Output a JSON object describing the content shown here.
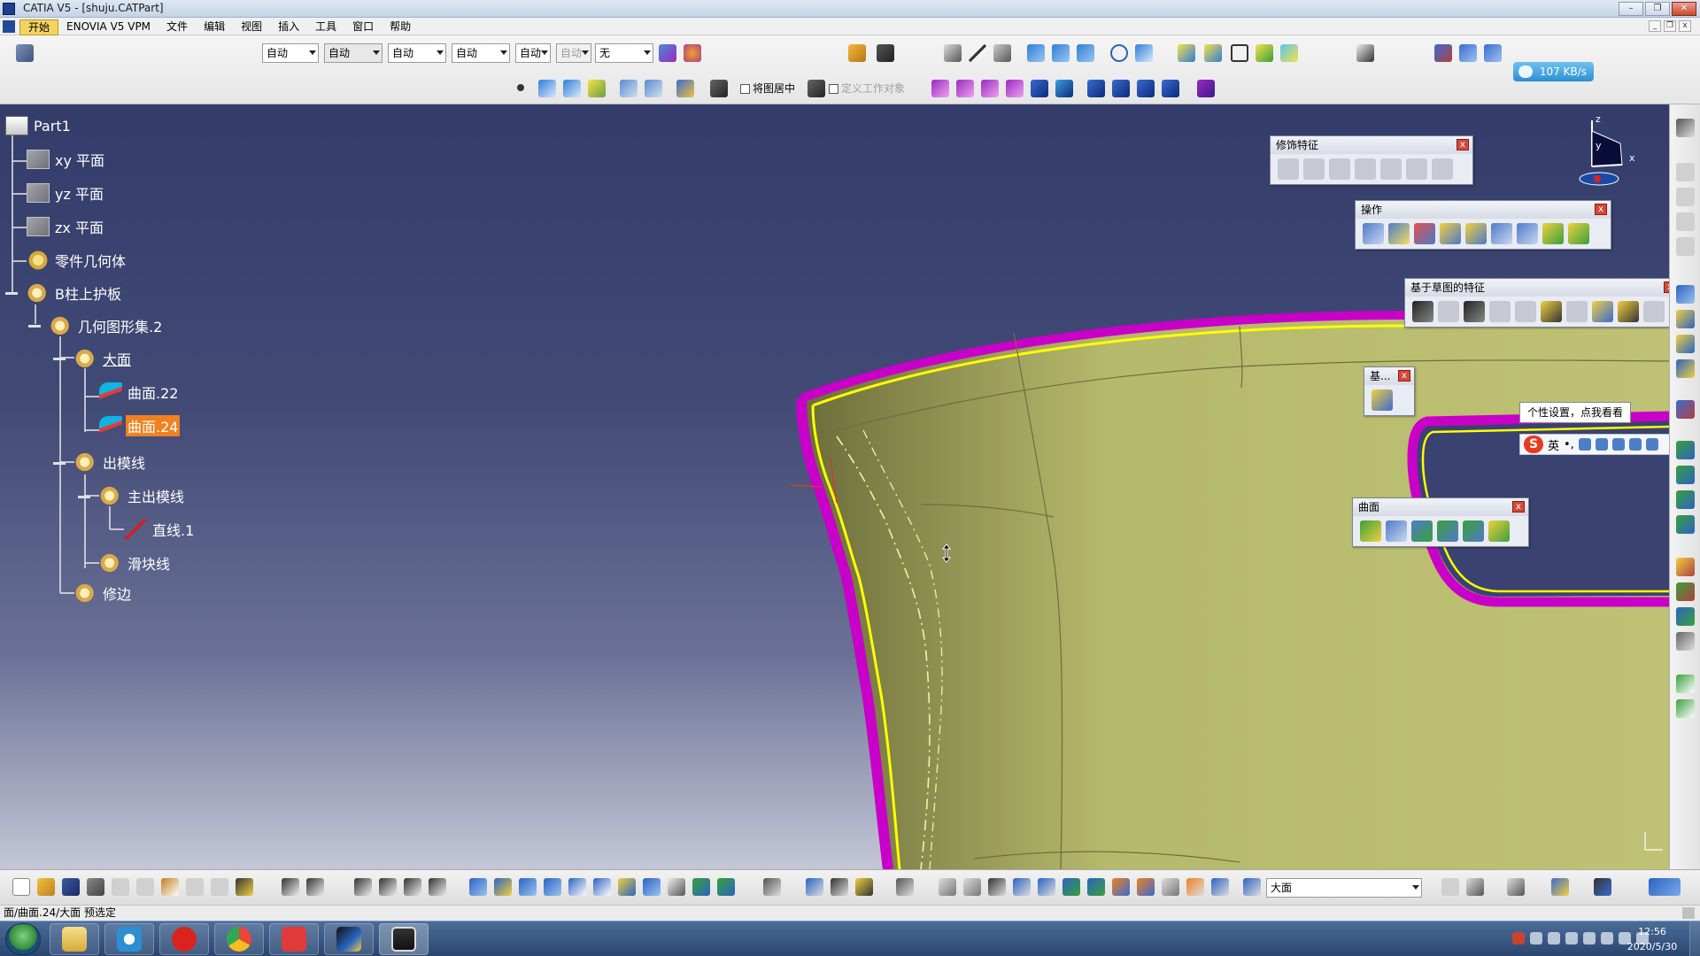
{
  "window": {
    "title": "CATIA V5 - [shuju.CATPart]",
    "controls": {
      "minimize": "–",
      "restore": "❐",
      "close": "✕"
    }
  },
  "menubar": {
    "items": [
      "开始",
      "ENOVIA V5 VPM",
      "文件",
      "编辑",
      "视图",
      "插入",
      "工具",
      "窗口",
      "帮助"
    ]
  },
  "toolbar": {
    "combos": [
      "自动",
      "自动",
      "自动",
      "自动",
      "自动",
      "自动",
      "无"
    ],
    "checkbox_center_graph": "将图居中",
    "checkbox_define_work": "定义工作对象",
    "net_speed": "107 KB/s"
  },
  "tree": {
    "root": "Part1",
    "nodes": [
      {
        "label": "xy 平面",
        "icon": "plane-icon"
      },
      {
        "label": "yz 平面",
        "icon": "plane-icon"
      },
      {
        "label": "zx 平面",
        "icon": "plane-icon"
      },
      {
        "label": "零件几何体",
        "icon": "body-gear-icon"
      },
      {
        "label": "B柱上护板",
        "icon": "geometric-set-icon"
      },
      {
        "label": "几何图形集.2",
        "icon": "geometric-set-icon"
      },
      {
        "label": "大面",
        "icon": "geometric-set-icon"
      },
      {
        "label": "曲面.22",
        "icon": "surface-icon"
      },
      {
        "label": "曲面.24",
        "icon": "surface-icon",
        "selected": true
      },
      {
        "label": "出模线",
        "icon": "geometric-set-icon"
      },
      {
        "label": "主出模线",
        "icon": "geometric-set-icon"
      },
      {
        "label": "直线.1",
        "icon": "line-icon"
      },
      {
        "label": "滑块线",
        "icon": "geometric-set-icon"
      },
      {
        "label": "修边",
        "icon": "geometric-set-icon"
      }
    ]
  },
  "palettes": {
    "dress_up": {
      "title": "修饰特征"
    },
    "operations": {
      "title": "操作"
    },
    "sketch_based": {
      "title": "基于草图的特征"
    },
    "base": {
      "title": "基..."
    },
    "surfaces": {
      "title": "曲面"
    }
  },
  "ime": {
    "tooltip": "个性设置，点我看看",
    "logo": "S",
    "lang": "英",
    "punct": "•,"
  },
  "compass": {
    "x": "x",
    "y": "y",
    "z": "z"
  },
  "bottom_toolbar": {
    "layer_combo": "大面"
  },
  "statusbar": {
    "text": "面/曲面.24/大面 预选定"
  },
  "taskbar": {
    "time": "12:56",
    "date": "2020/5/30"
  },
  "colors": {
    "background_top": "#333c6a",
    "surface_fill": "#b7bb6c",
    "edge_magenta": "#c800c8",
    "edge_yellow": "#ffff00",
    "selection_orange": "#f08020"
  }
}
